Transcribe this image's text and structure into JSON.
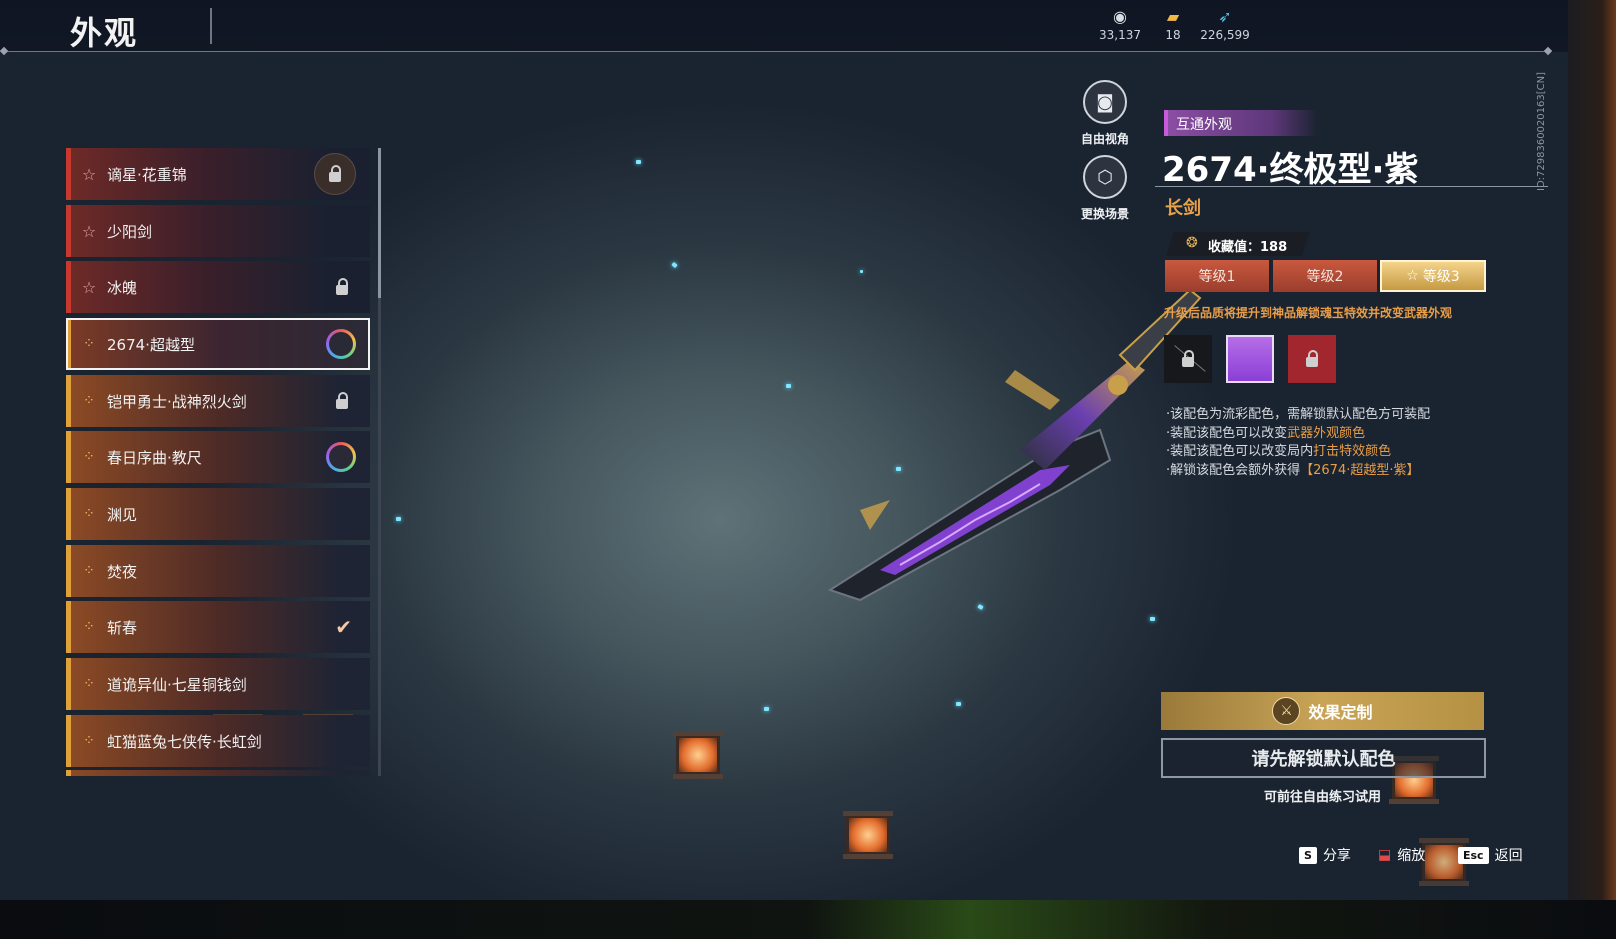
{
  "header": {
    "title": "外观",
    "currencies": [
      {
        "icon": "coin-icon",
        "value": "33,137"
      },
      {
        "icon": "ticket-icon",
        "value": "18"
      },
      {
        "icon": "feather-icon",
        "value": "226,599"
      }
    ]
  },
  "skin_list": [
    {
      "label": "谪星·花重锦",
      "rarity": "red",
      "status": "locked-big"
    },
    {
      "label": "少阳剑",
      "rarity": "red",
      "status": ""
    },
    {
      "label": "冰魄",
      "rarity": "red",
      "status": "locked"
    },
    {
      "label": "2674·超越型",
      "rarity": "gold",
      "status": "color-ring",
      "selected": true
    },
    {
      "label": "铠甲勇士·战神烈火剑",
      "rarity": "gold",
      "status": "locked"
    },
    {
      "label": "春日序曲·教尺",
      "rarity": "gold",
      "status": "color-ring"
    },
    {
      "label": "渊见",
      "rarity": "gold",
      "status": ""
    },
    {
      "label": "焚夜",
      "rarity": "gold",
      "status": ""
    },
    {
      "label": "斩春",
      "rarity": "gold",
      "status": "equipped"
    },
    {
      "label": "道诡异仙·七星铜钱剑",
      "rarity": "gold",
      "status": ""
    },
    {
      "label": "虹猫蓝兔七侠传·长虹剑",
      "rarity": "gold",
      "status": ""
    }
  ],
  "camera": {
    "free_view": "自由视角",
    "change_scene": "更换场景"
  },
  "detail": {
    "tag": "互通外观",
    "name": "2674·终极型·紫",
    "weapon_type": "长剑",
    "collection": "收藏值：188",
    "levels": [
      "等级1",
      "等级2",
      "等级3"
    ],
    "active_level": "等级3",
    "upgrade_hint": "升级后品质将提升到神品解锁魂玉特效并改变武器外观",
    "swatches": [
      {
        "color": "#16181c",
        "locked": true
      },
      {
        "color": "#a855e0",
        "locked": false,
        "selected": true
      },
      {
        "color": "#a2262e",
        "locked": true
      }
    ],
    "notes": {
      "n1": "·该配色为流彩配色，需解锁默认配色方可装配",
      "n2_a": "·装配该配色可以改变",
      "n2_b": "武器外观颜色",
      "n3_a": "·装配该配色可以改变局内",
      "n3_b": "打击特效颜色",
      "n4_a": "·解锁该配色会额外获得",
      "n4_b": "【2674·超越型·紫】"
    },
    "effect_button": "效果定制",
    "unlock_button": "请先解锁默认配色",
    "try_hint": "可前往自由练习试用"
  },
  "footer": {
    "share_key": "S",
    "share_label": "分享",
    "zoom_label": "缩放",
    "back_key": "Esc",
    "back_label": "返回"
  },
  "version_id": "ID:7298360020163[CN]"
}
